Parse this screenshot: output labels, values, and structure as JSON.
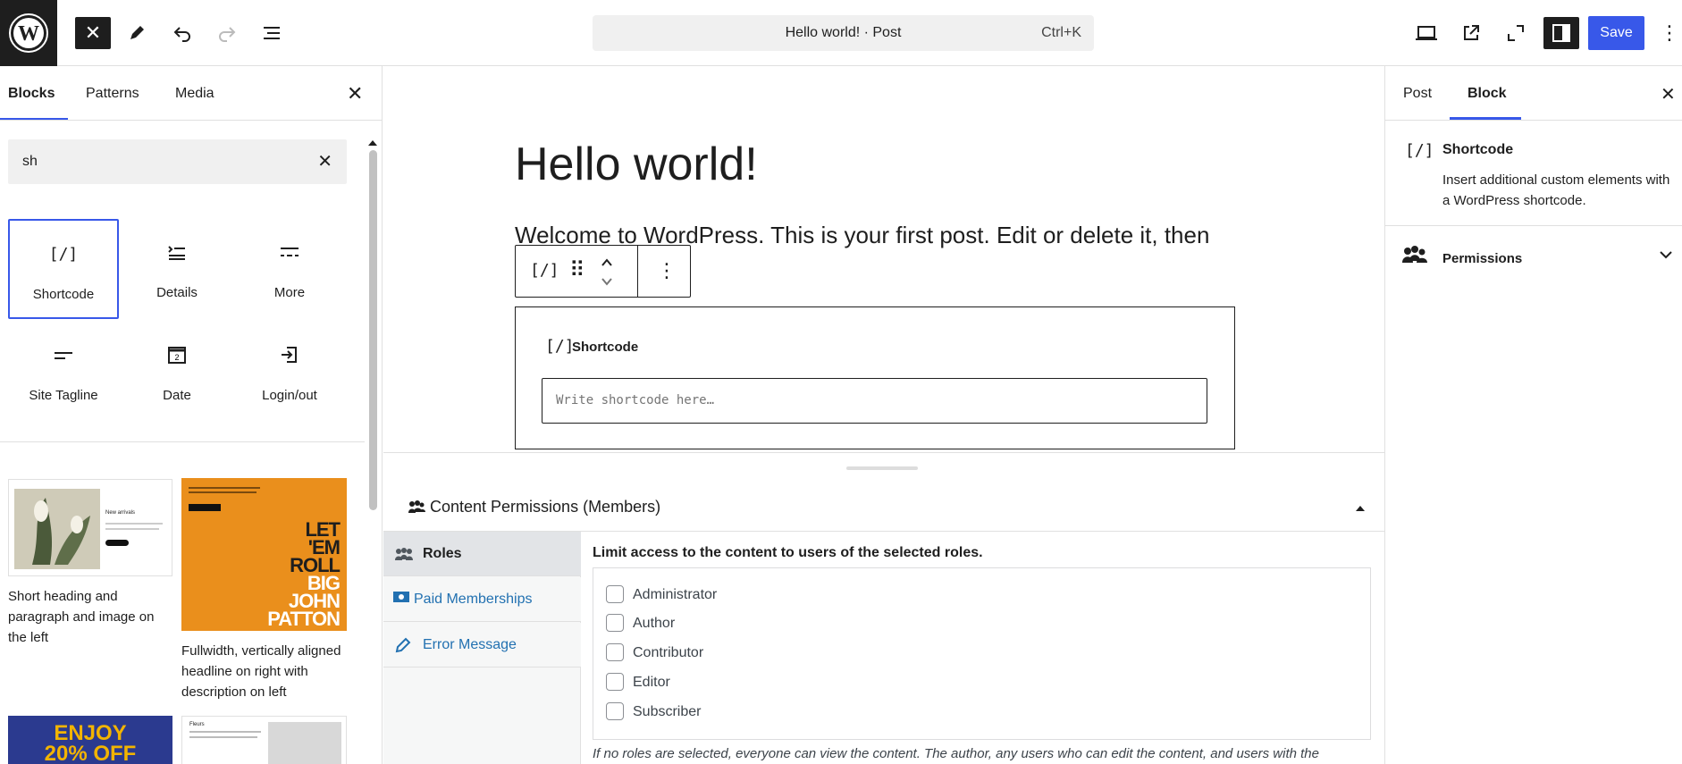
{
  "topbar": {
    "document_title": "Hello world! · Post",
    "shortcut": "Ctrl+K",
    "save_label": "Save"
  },
  "inserter": {
    "tabs": [
      "Blocks",
      "Patterns",
      "Media"
    ],
    "search_value": "sh",
    "blocks": [
      {
        "label": "Shortcode",
        "icon": "shortcode-icon"
      },
      {
        "label": "Details",
        "icon": "details-icon"
      },
      {
        "label": "More",
        "icon": "more-icon"
      },
      {
        "label": "Site Tagline",
        "icon": "site-tagline-icon"
      },
      {
        "label": "Date",
        "icon": "date-icon"
      },
      {
        "label": "Login/out",
        "icon": "login-icon"
      }
    ],
    "patterns": [
      {
        "caption": "Short heading and paragraph and image on the left",
        "thumb_heading": "New arrivals"
      },
      {
        "caption": "Fullwidth, vertically aligned headline on right with description on left",
        "thumb_text": "LET 'EM ROLL BIG JOHN PATTON",
        "thumb_color": "#ea8f1c"
      },
      {
        "thumb_text": "ENJOY 20% OFF",
        "thumb_color": "#2b3a8f",
        "thumb_text_color": "#f2b400"
      },
      {
        "thumb_heading": "Fleurs"
      }
    ]
  },
  "editor": {
    "title": "Hello world!",
    "body": "Welcome to WordPress. This is your first post. Edit or delete it, then",
    "shortcode_block": {
      "label": "Shortcode",
      "placeholder": "Write shortcode here…"
    }
  },
  "metabox": {
    "title": "Content Permissions (Members)",
    "nav": [
      {
        "label": "Roles",
        "icon": "roles-icon"
      },
      {
        "label": "Paid Memberships",
        "icon": "money-icon"
      },
      {
        "label": "Error Message",
        "icon": "pencil-icon"
      }
    ],
    "limit_label": "Limit access to the content to users of the selected roles.",
    "roles": [
      "Administrator",
      "Author",
      "Contributor",
      "Editor",
      "Subscriber"
    ],
    "note": "If no roles are selected, everyone can view the content. The author, any users who can edit the content, and users with the"
  },
  "sidebar": {
    "tabs": [
      "Post",
      "Block"
    ],
    "block_name": "Shortcode",
    "block_desc": "Insert additional custom elements with a WordPress shortcode.",
    "permissions_label": "Permissions"
  },
  "colors": {
    "accent": "#3858e9",
    "link": "#2271b1",
    "dark": "#1e1e1e"
  }
}
